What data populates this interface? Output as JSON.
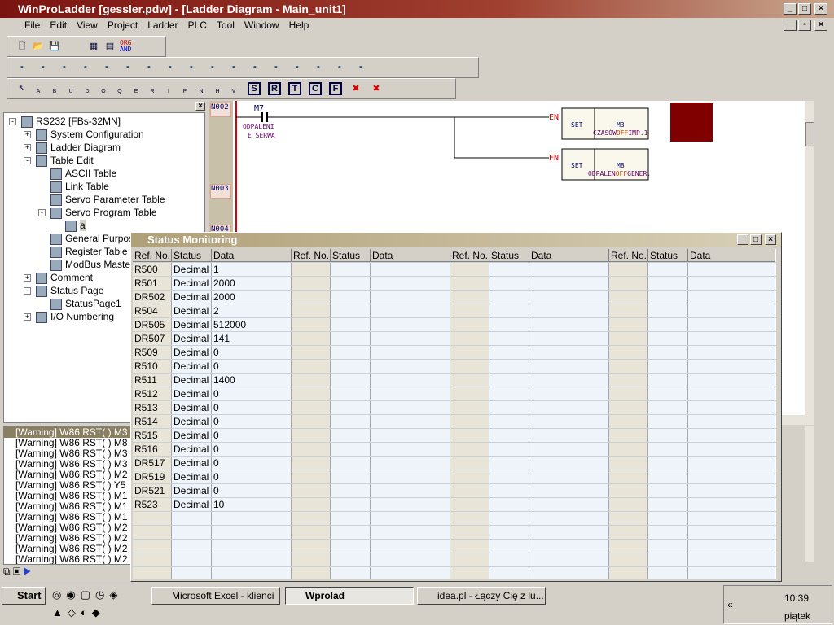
{
  "window": {
    "title": "WinProLadder [gessler.pdw] - [Ladder Diagram - Main_unit1]"
  },
  "menu": [
    "File",
    "Edit",
    "View",
    "Project",
    "Ladder",
    "PLC",
    "Tool",
    "Window",
    "Help"
  ],
  "toolbar1": {
    "org_label": "ORG",
    "and_label": "AND"
  },
  "toolbar3": {
    "contacts": [
      "A",
      "B",
      "U",
      "D",
      "O",
      "Q",
      "E",
      "R",
      "I",
      "P",
      "N",
      "H",
      "V"
    ],
    "boxes": [
      "S",
      "R",
      "T",
      "C",
      "F"
    ]
  },
  "tree": [
    {
      "label": "RS232 [FBs-32MN]",
      "level": 0,
      "exp": "-"
    },
    {
      "label": "System Configuration",
      "level": 1,
      "exp": "+"
    },
    {
      "label": "Ladder Diagram",
      "level": 1,
      "exp": "+"
    },
    {
      "label": "Table Edit",
      "level": 1,
      "exp": "-"
    },
    {
      "label": "ASCII Table",
      "level": 2,
      "exp": ""
    },
    {
      "label": "Link Table",
      "level": 2,
      "exp": ""
    },
    {
      "label": "Servo Parameter Table",
      "level": 2,
      "exp": ""
    },
    {
      "label": "Servo Program Table",
      "level": 2,
      "exp": "-"
    },
    {
      "label": "a",
      "level": 3,
      "exp": ""
    },
    {
      "label": "General Purpose",
      "level": 2,
      "exp": ""
    },
    {
      "label": "Register Table",
      "level": 2,
      "exp": ""
    },
    {
      "label": "ModBus Master",
      "level": 2,
      "exp": ""
    },
    {
      "label": "Comment",
      "level": 1,
      "exp": "+"
    },
    {
      "label": "Status Page",
      "level": 1,
      "exp": "-"
    },
    {
      "label": "StatusPage1",
      "level": 2,
      "exp": ""
    },
    {
      "label": "I/O Numbering",
      "level": 1,
      "exp": "+"
    }
  ],
  "ladder": {
    "networks": [
      "N002",
      "N003",
      "N004"
    ],
    "contact": {
      "name": "M7",
      "comment1": "ODPALENI",
      "comment2": "E SERWA"
    },
    "en": "EN",
    "coils": [
      {
        "fn": "SET",
        "ref": "M3",
        "comment": "CZASÓW",
        "state": "OFF",
        "comment2": "IMP.1"
      },
      {
        "fn": "SET",
        "ref": "M8",
        "comment": "ODPALEN",
        "state": "OFF",
        "comment2": "GENER."
      }
    ]
  },
  "output": [
    "[Warning] W86  RST( )   M3",
    "[Warning] W86  RST( )   M8",
    "[Warning] W86  RST( )   M3",
    "[Warning] W86  RST( )   M3",
    "[Warning] W86  RST( )   M2",
    "[Warning] W86  RST( )   Y5",
    "[Warning] W86  RST( )   M1",
    "[Warning] W86  RST( )   M1",
    "[Warning] W86  RST( )   M1",
    "[Warning] W86  RST( )   M2",
    "[Warning] W86  RST( )   M2",
    "[Warning] W86  RST( )   M2",
    "[Warning] W86  RST( )   M2"
  ],
  "status": {
    "title": "Status Monitoring",
    "headers": [
      "Ref. No.",
      "Status",
      "Data"
    ],
    "rows": [
      [
        "R500",
        "Decimal",
        "1"
      ],
      [
        "R501",
        "Decimal",
        "2000"
      ],
      [
        "DR502",
        "Decimal",
        "2000"
      ],
      [
        "R504",
        "Decimal",
        "2"
      ],
      [
        "DR505",
        "Decimal",
        "512000"
      ],
      [
        "DR507",
        "Decimal",
        "141"
      ],
      [
        "R509",
        "Decimal",
        "0"
      ],
      [
        "R510",
        "Decimal",
        "0"
      ],
      [
        "R511",
        "Decimal",
        "1400"
      ],
      [
        "R512",
        "Decimal",
        "0"
      ],
      [
        "R513",
        "Decimal",
        "0"
      ],
      [
        "R514",
        "Decimal",
        "0"
      ],
      [
        "R515",
        "Decimal",
        "0"
      ],
      [
        "R516",
        "Decimal",
        "0"
      ],
      [
        "DR517",
        "Decimal",
        "0"
      ],
      [
        "DR519",
        "Decimal",
        "0"
      ],
      [
        "DR521",
        "Decimal",
        "0"
      ],
      [
        "R523",
        "Decimal",
        "10"
      ]
    ]
  },
  "taskbar": {
    "start": "Start",
    "tasks": [
      "Microsoft Excel - klienci",
      "Wprolad",
      "idea.pl - Łączy Cię z lu..."
    ],
    "time": "10:39",
    "day": "piątek"
  },
  "colors": {
    "title": "#7a1410",
    "coil_block": "#800000",
    "rail": "#e00000"
  }
}
